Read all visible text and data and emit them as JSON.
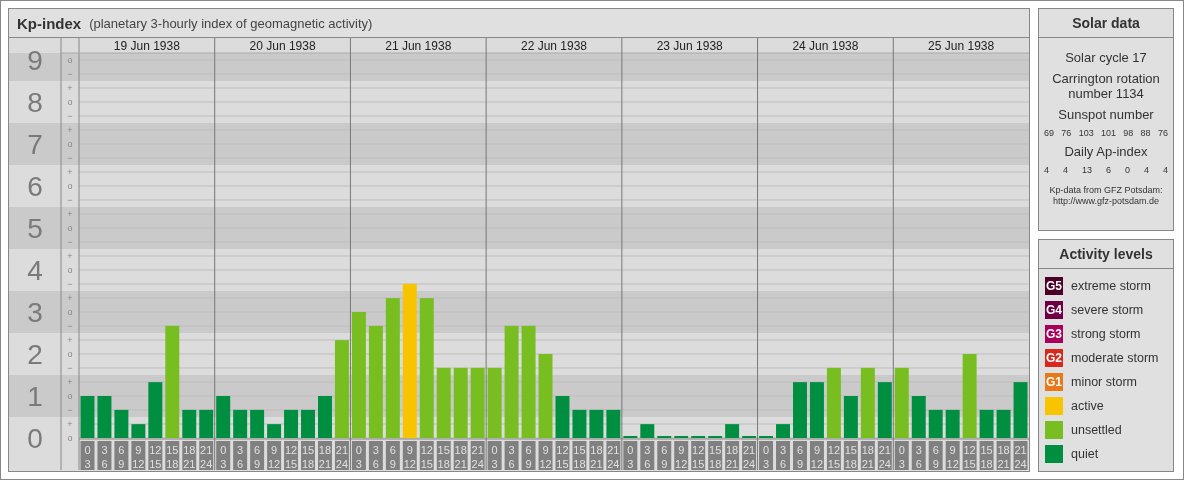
{
  "chart_panel": {
    "title": "Kp-index",
    "subtitle": "(planetary 3-hourly index of geomagnetic activity)",
    "minor_labels": [
      "o",
      "−",
      "+",
      "o",
      "−",
      "+",
      "o",
      "−",
      "+",
      "o",
      "−",
      "+",
      "o",
      "−",
      "+",
      "o",
      "−",
      "+",
      "o",
      "−",
      "+",
      "o",
      "−",
      "+",
      "o",
      "−",
      "+",
      "o"
    ],
    "days": [
      {
        "date": "19 Jun 1938",
        "slots": [
          {
            "from": "0",
            "to": "3"
          },
          {
            "from": "3",
            "to": "6"
          },
          {
            "from": "6",
            "to": "9"
          },
          {
            "from": "9",
            "to": "12"
          },
          {
            "from": "12",
            "to": "15"
          },
          {
            "from": "15",
            "to": "18"
          },
          {
            "from": "18",
            "to": "21"
          },
          {
            "from": "21",
            "to": "24"
          }
        ]
      },
      {
        "date": "20 Jun 1938",
        "slots": [
          {
            "from": "0",
            "to": "3"
          },
          {
            "from": "3",
            "to": "6"
          },
          {
            "from": "6",
            "to": "9"
          },
          {
            "from": "9",
            "to": "12"
          },
          {
            "from": "12",
            "to": "15"
          },
          {
            "from": "15",
            "to": "18"
          },
          {
            "from": "18",
            "to": "21"
          },
          {
            "from": "21",
            "to": "24"
          }
        ]
      },
      {
        "date": "21 Jun 1938",
        "slots": [
          {
            "from": "0",
            "to": "3"
          },
          {
            "from": "3",
            "to": "6"
          },
          {
            "from": "6",
            "to": "9"
          },
          {
            "from": "9",
            "to": "12"
          },
          {
            "from": "12",
            "to": "15"
          },
          {
            "from": "15",
            "to": "18"
          },
          {
            "from": "18",
            "to": "21"
          },
          {
            "from": "21",
            "to": "24"
          }
        ]
      },
      {
        "date": "22 Jun 1938",
        "slots": [
          {
            "from": "0",
            "to": "3"
          },
          {
            "from": "3",
            "to": "6"
          },
          {
            "from": "6",
            "to": "9"
          },
          {
            "from": "9",
            "to": "12"
          },
          {
            "from": "12",
            "to": "15"
          },
          {
            "from": "15",
            "to": "18"
          },
          {
            "from": "18",
            "to": "21"
          },
          {
            "from": "21",
            "to": "24"
          }
        ]
      },
      {
        "date": "23 Jun 1938",
        "slots": [
          {
            "from": "0",
            "to": "3"
          },
          {
            "from": "3",
            "to": "6"
          },
          {
            "from": "6",
            "to": "9"
          },
          {
            "from": "9",
            "to": "12"
          },
          {
            "from": "12",
            "to": "15"
          },
          {
            "from": "15",
            "to": "18"
          },
          {
            "from": "18",
            "to": "21"
          },
          {
            "from": "21",
            "to": "24"
          }
        ]
      },
      {
        "date": "24 Jun 1938",
        "slots": [
          {
            "from": "0",
            "to": "3"
          },
          {
            "from": "3",
            "to": "6"
          },
          {
            "from": "6",
            "to": "9"
          },
          {
            "from": "9",
            "to": "12"
          },
          {
            "from": "12",
            "to": "15"
          },
          {
            "from": "15",
            "to": "18"
          },
          {
            "from": "18",
            "to": "21"
          },
          {
            "from": "21",
            "to": "24"
          }
        ]
      },
      {
        "date": "25 Jun 1938",
        "slots": [
          {
            "from": "0",
            "to": "3"
          },
          {
            "from": "3",
            "to": "6"
          },
          {
            "from": "6",
            "to": "9"
          },
          {
            "from": "9",
            "to": "12"
          },
          {
            "from": "12",
            "to": "15"
          },
          {
            "from": "15",
            "to": "18"
          },
          {
            "from": "18",
            "to": "21"
          },
          {
            "from": "21",
            "to": "24"
          }
        ]
      }
    ],
    "chart_data": {
      "type": "bar",
      "ylim": [
        0,
        9
      ],
      "yticks": [
        0,
        1,
        2,
        3,
        4,
        5,
        6,
        7,
        8,
        9
      ],
      "grid": true,
      "series": [
        {
          "values": [
            1,
            1,
            0.67,
            0.33,
            1.33,
            2.67,
            0.67,
            0.67,
            1,
            0.67,
            0.67,
            0.33,
            0.67,
            0.67,
            1,
            2.33,
            3,
            2.67,
            3.33,
            3.67,
            3.33,
            1.67,
            1.67,
            1.67,
            1.67,
            2.67,
            2.67,
            2,
            1,
            0.67,
            0.67,
            0.67,
            0,
            0.33,
            0,
            0,
            0,
            0,
            0.33,
            0,
            0,
            0.33,
            1.33,
            1.33,
            1.67,
            1,
            1.67,
            1.33,
            1.67,
            1,
            0.67,
            0.67,
            2,
            0.67,
            0.67,
            1.33
          ]
        }
      ]
    }
  },
  "solar_data": {
    "title": "Solar data",
    "cycle": "Solar cycle 17",
    "rotation": "Carrington rotation number 1134",
    "sunspot_title": "Sunspot number",
    "sunspots": [
      "69",
      "76",
      "103",
      "101",
      "98",
      "88",
      "76"
    ],
    "ap_title": "Daily Ap-index",
    "ap": [
      "4",
      "4",
      "13",
      "6",
      "0",
      "4",
      "4"
    ],
    "source": "Kp-data from GFZ Potsdam:",
    "source_url": "http://www.gfz-potsdam.de"
  },
  "activity_levels": {
    "title": "Activity levels",
    "items": [
      {
        "badge": "G5",
        "label": "extreme storm",
        "color": "#4d0026"
      },
      {
        "badge": "G4",
        "label": "severe storm",
        "color": "#6d0042"
      },
      {
        "badge": "G3",
        "label": "strong storm",
        "color": "#a8005a"
      },
      {
        "badge": "G2",
        "label": "moderate storm",
        "color": "#d8281c"
      },
      {
        "badge": "G1",
        "label": "minor storm",
        "color": "#e87818"
      },
      {
        "label": "active",
        "color": "#f8c400"
      },
      {
        "label": "unsettled",
        "color": "#78be20"
      },
      {
        "label": "quiet",
        "color": "#008e40"
      }
    ]
  }
}
